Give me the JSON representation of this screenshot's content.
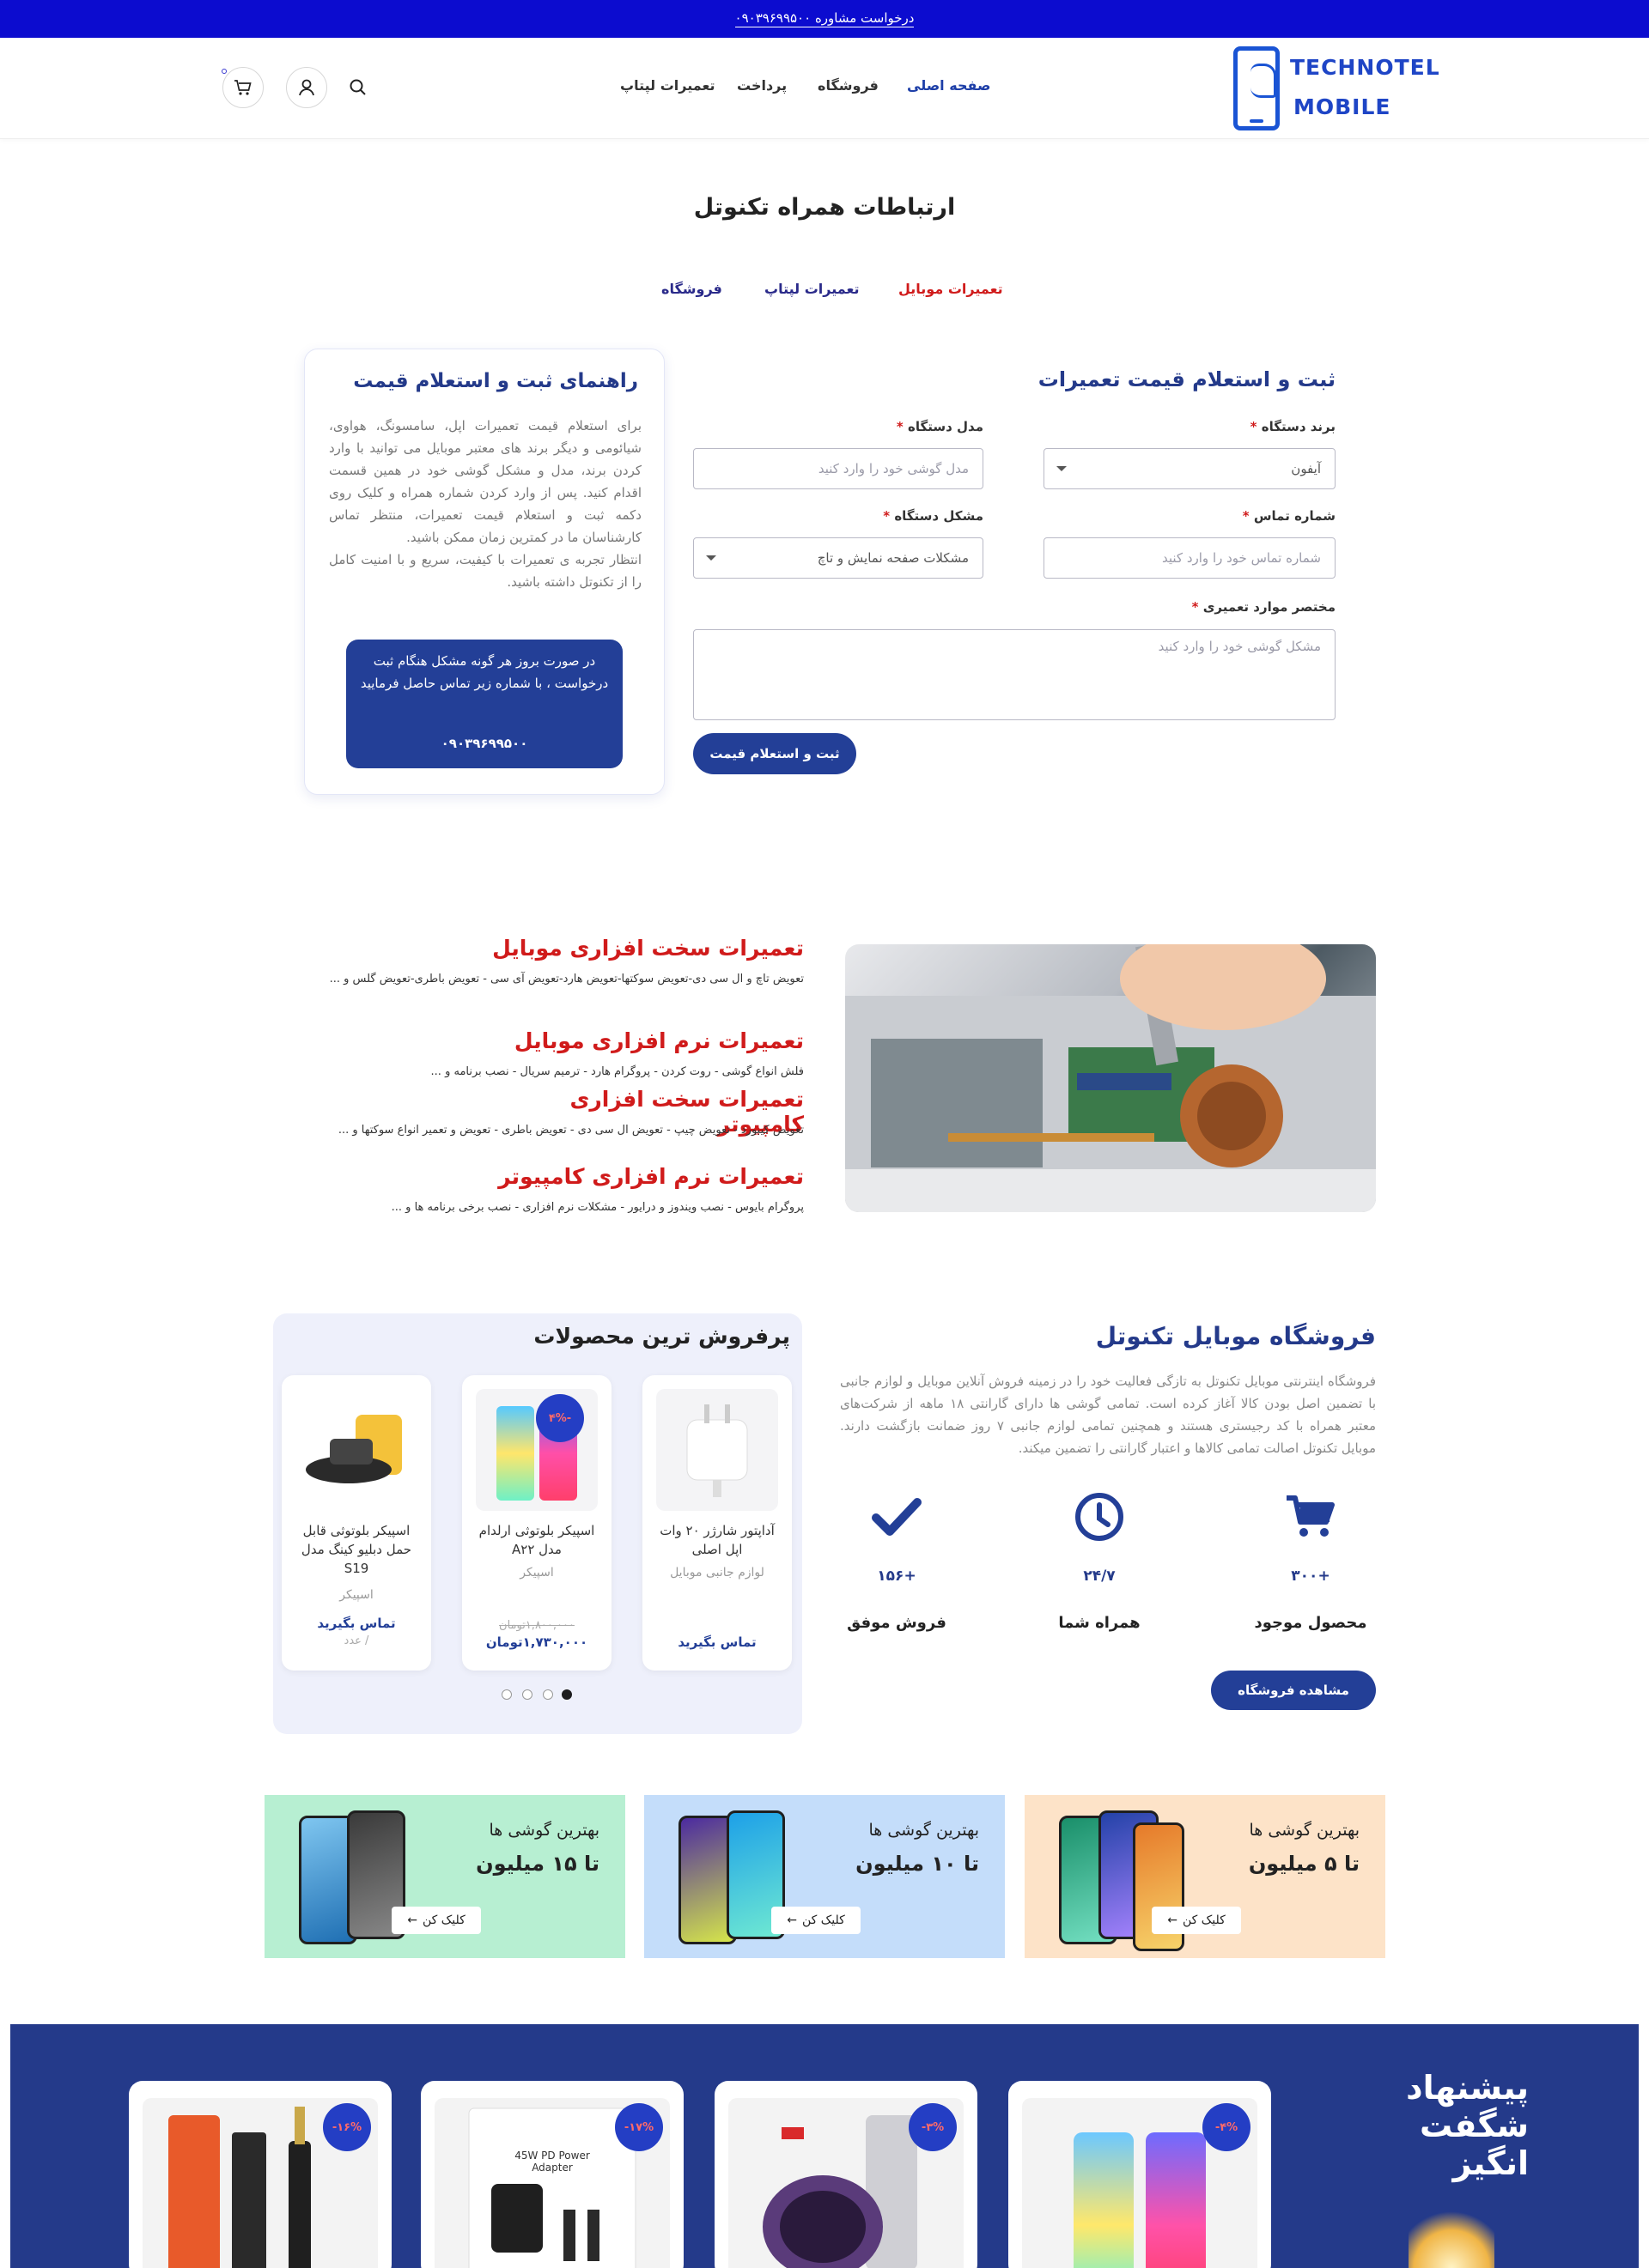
{
  "topbar": {
    "text": "درخواست مشاوره ۰۹۰۳۹۶۹۹۵۰۰"
  },
  "logo": {
    "line1": "TECHNOTEL",
    "line2": "MOBILE"
  },
  "nav": {
    "home": "صفحه اصلی",
    "shop": "فروشگاه",
    "payment": "پرداخت",
    "laptop_repair": "تعمیرات لپتاپ"
  },
  "header_icons": [
    "search-icon",
    "user-icon",
    "cart-icon"
  ],
  "page_title": "ارتباطات همراه تکنوتل",
  "tabs": [
    "تعمیرات موبایل",
    "تعمیرات لپتاپ",
    "فروشگاه"
  ],
  "form": {
    "title": "ثبت و استعلام قیمت تعمیرات",
    "brand_label": "برند دستگاه",
    "brand_value": "آیفون",
    "model_label": "مدل دستگاه",
    "model_placeholder": "مدل گوشی خود را وارد کنید",
    "phone_label": "شماره تماس",
    "phone_placeholder": "شماره تماس خود را وارد کنید",
    "issue_label": "مشکل دستگاه",
    "issue_value": "مشکلات صفحه نمایش و تاچ",
    "summary_label": "مختصر موارد تعمیری",
    "summary_placeholder": "مشکل گوشی خود را وارد کنید",
    "submit": "ثبت و استعلام قیمت",
    "required_mark": "*"
  },
  "guide": {
    "title": "راهنمای ثبت و استعلام قیمت",
    "text": "برای استعلام قیمت تعمیرات اپل، سامسونگ، هواوی، شیائومی و دیگر برند های معتبر موبایل می توانید با وارد کردن برند، مدل و مشکل گوشی خود در همین قسمت اقدام کنید. پس از وارد کردن شماره همراه و کلیک روی دکمه ثبت و استعلام قیمت تعمیرات، منتظر تماس کارشناسان ما در کمترین زمان ممکن باشید.",
    "text2": "انتظار تجربه ی تعمیرات با کیفیت، سریع و با امنیت کامل را از تکنوتل داشته باشید.",
    "box_text": "در صورت بروز هر گونه مشکل هنگام ثبت درخواست ، با شماره زیر تماس حاصل فرمایید",
    "box_phone": "۰۹۰۳۹۶۹۹۵۰۰"
  },
  "services": [
    {
      "title": "تعمیرات سخت افزاری موبایل",
      "desc": "تعویض تاچ و ال سی دی-تعویض سوکتها-تعویض هارد-تعویض آی سی - تعویض باطری-تعویض گلس و ..."
    },
    {
      "title": "تعمیرات نرم افزاری موبایل",
      "desc": "فلش انواع گوشی - روت کردن - پروگرام هارد - ترمیم سریال - نصب برنامه و ..."
    },
    {
      "title": "تعمیرات سخت افزاری کامپیوتر",
      "desc": "تعویض کیبورد - تعویض چیپ - تعویض ال سی دی - تعویض باطری - تعویض و تعمیر انواع سوکتها و ..."
    },
    {
      "title": "تعمیرات نرم افزاری کامپیوتر",
      "desc": "پروگرام بایوس - نصب ویندوز و درایور - مشکلات نرم افزاری - نصب برخی برنامه ها و ..."
    }
  ],
  "store": {
    "title": "فروشگاه موبایل تکنوتل",
    "desc": "فروشگاه اینترنتی موبایل تکنوتل به تازگی فعالیت خود را در زمینه فروش آنلاین موبایل و لوازم جانبی با تضمین اصل بودن کالا آغاز کرده است. تمامی گوشی ها دارای گارانتی ۱۸ ماهه از شرکت‌های معتبر همراه با کد رجیستری هستند و همچنین تمامی لوازم جانبی ۷ روز ضمانت بازگشت دارند. موبایل تکنوتل اصالت تمامی کالاها و اعتبار گارانتی را تضمین میکند.",
    "stats": [
      {
        "icon": "cart-icon",
        "num": "+۳۰۰",
        "label": "محصول موجود"
      },
      {
        "icon": "clock-icon",
        "num": "۲۴/۷",
        "label": "همراه شما"
      },
      {
        "icon": "check-icon",
        "num": "+۱۵۶",
        "label": "فروش موفق"
      }
    ],
    "button": "مشاهده فروشگاه"
  },
  "best": {
    "title": "پرفروش ترین محصولات",
    "products": [
      {
        "name": "آداپتور شارژر ۲۰ وات اپل اصلی",
        "category": "لوازم جانبی موبایل",
        "price": "تماس بگیرید",
        "old_price": "",
        "extra": "",
        "badge": ""
      },
      {
        "name": "اسپیکر بلوتوثی ارلدام مدل A۲۲",
        "category": "اسپیکر",
        "price": "۱,۷۳۰,۰۰۰تومان",
        "old_price": "۱,۸۰۰,۰۰۰تومان",
        "extra": "",
        "badge": "-۴%"
      },
      {
        "name": "اسپیکر بلوتوثی قابل حمل دبلیو کینگ مدل S19",
        "category": "اسپیکر",
        "price": "تماس بگیرید",
        "old_price": "",
        "extra": "/ عدد",
        "badge": ""
      }
    ],
    "dots": 4
  },
  "banners": [
    {
      "line1": "بهترین گوشی ها",
      "line2": "تا ۵ میلیون",
      "button": "کلیک کن",
      "color": "#fde3c8"
    },
    {
      "line1": "بهترین گوشی ها",
      "line2": "تا ۱۰ میلیون",
      "button": "کلیک کن",
      "color": "#c4ddfa"
    },
    {
      "line1": "بهترین گوشی ها",
      "line2": "تا ۱۵ میلیون",
      "button": "کلیک کن",
      "color": "#b7efd2"
    }
  ],
  "offer": {
    "title_line1": "پیشنهاد",
    "title_line2": "شگفت",
    "title_line3": "انگیز",
    "badges": [
      "-۴%",
      "-۳%",
      "-۱۷%",
      "-۱۶%"
    ]
  },
  "colors": {
    "brand_blue": "#233f97",
    "topbar": "#0c0ccf",
    "accent_red": "#d01b1b",
    "offer_bg": "#243a8a"
  }
}
